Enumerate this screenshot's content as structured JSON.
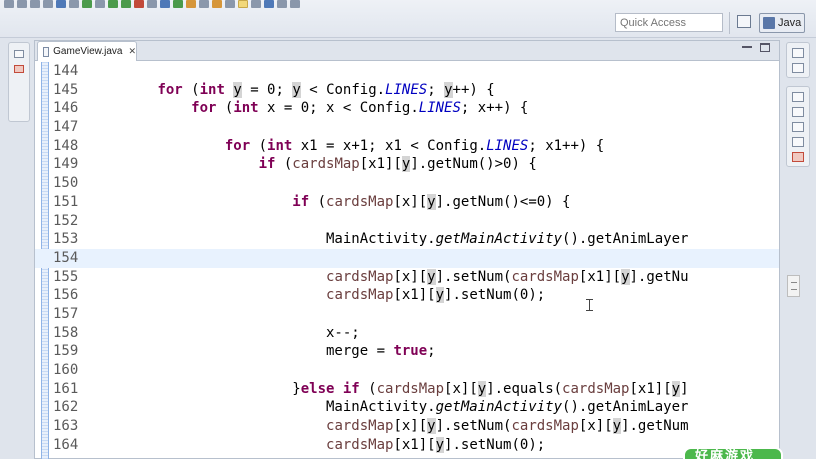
{
  "toolbar": {
    "quick_access_placeholder": "Quick Access",
    "perspective_label": "Java"
  },
  "editor": {
    "tab_title": "GameView.java",
    "lines": [
      {
        "n": "144",
        "code": ""
      },
      {
        "n": "145",
        "code": "        for (int y = 0; y < Config.LINES; y++) {"
      },
      {
        "n": "146",
        "code": "            for (int x = 0; x < Config.LINES; x++) {"
      },
      {
        "n": "147",
        "code": ""
      },
      {
        "n": "148",
        "code": "                for (int x1 = x+1; x1 < Config.LINES; x1++) {"
      },
      {
        "n": "149",
        "code": "                    if (cardsMap[x1][y].getNum()>0) {"
      },
      {
        "n": "150",
        "code": ""
      },
      {
        "n": "151",
        "code": "                        if (cardsMap[x][y].getNum()<=0) {"
      },
      {
        "n": "152",
        "code": ""
      },
      {
        "n": "153",
        "code": "                            MainActivity.getMainActivity().getAnimLayer"
      },
      {
        "n": "154",
        "code": ""
      },
      {
        "n": "155",
        "code": "                            cardsMap[x][y].setNum(cardsMap[x1][y].getNu"
      },
      {
        "n": "156",
        "code": "                            cardsMap[x1][y].setNum(0);"
      },
      {
        "n": "157",
        "code": ""
      },
      {
        "n": "158",
        "code": "                            x--;"
      },
      {
        "n": "159",
        "code": "                            merge = true;"
      },
      {
        "n": "160",
        "code": ""
      },
      {
        "n": "161",
        "code": "                        }else if (cardsMap[x][y].equals(cardsMap[x1][y]"
      },
      {
        "n": "162",
        "code": "                            MainActivity.getMainActivity().getAnimLayer"
      },
      {
        "n": "163",
        "code": "                            cardsMap[x][y].setNum(cardsMap[x][y].getNum"
      },
      {
        "n": "164",
        "code": "                            cardsMap[x1][y].setNum(0);"
      }
    ]
  },
  "watermark_text": "好麻游戏",
  "colors": {
    "keyword": "#7f0055",
    "static_field": "#0000c0",
    "field": "#6a3e3e",
    "current_line": "#e8f2fe",
    "badge": "#4cb84c"
  }
}
